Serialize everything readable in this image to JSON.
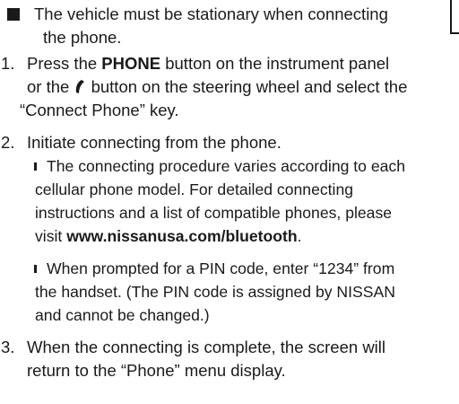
{
  "note": {
    "line1": "The vehicle must be stationary when connecting",
    "line2": "the phone."
  },
  "steps": [
    {
      "num": "1.",
      "l1_pre": "Press the ",
      "l1_bold": "PHONE",
      "l1_post": " button on the instrument panel",
      "l2_pre": "or the ",
      "l2_post": " button on the steering wheel and select the",
      "l3": "“Connect Phone” key."
    },
    {
      "num": "2.",
      "l1": "Initiate connecting from the phone.",
      "subs": [
        {
          "l1": "The connecting procedure varies according to each",
          "l2": "cellular phone model. For detailed connecting",
          "l3": "instructions and a list of compatible phones, please",
          "l4_pre": "visit ",
          "l4_bold": "www.nissanusa.com/bluetooth",
          "l4_post": "."
        },
        {
          "l1": "When prompted for a PIN code, enter “1234” from",
          "l2": "the handset. (The PIN code is assigned by NISSAN",
          "l3": "and cannot be changed.)"
        }
      ]
    },
    {
      "num": "3.",
      "l1": "When the connecting is complete, the screen will",
      "l2": "return to the “Phone” menu display."
    }
  ]
}
